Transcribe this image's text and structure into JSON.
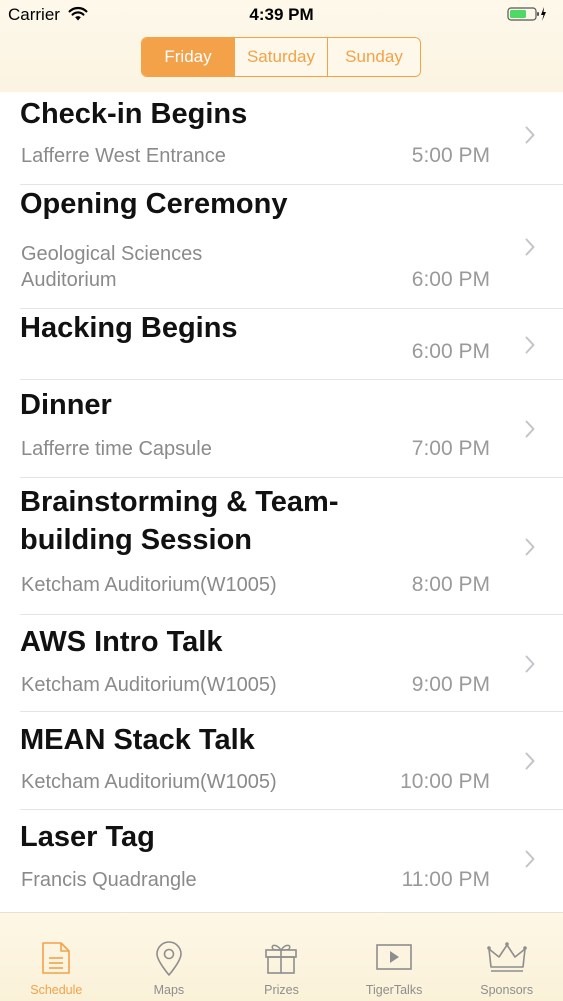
{
  "status_bar": {
    "carrier": "Carrier",
    "time": "4:39 PM"
  },
  "day_selector": {
    "days": [
      {
        "label": "Friday",
        "active": true
      },
      {
        "label": "Saturday",
        "active": false
      },
      {
        "label": "Sunday",
        "active": false
      }
    ]
  },
  "events": [
    {
      "title": "Check-in Begins",
      "location": "Lafferre West Entrance",
      "time": "5:00 PM"
    },
    {
      "title": "Opening Ceremony",
      "location": "Geological Sciences Auditorium",
      "time": "6:00 PM"
    },
    {
      "title": "Hacking Begins",
      "location": "",
      "time": "6:00 PM"
    },
    {
      "title": "Dinner",
      "location": "Lafferre time Capsule",
      "time": "7:00 PM"
    },
    {
      "title": "Brainstorming & Team-building Session",
      "location": "Ketcham Auditorium(W1005)",
      "time": "8:00 PM"
    },
    {
      "title": "AWS Intro Talk",
      "location": "Ketcham Auditorium(W1005)",
      "time": "9:00 PM"
    },
    {
      "title": "MEAN Stack Talk",
      "location": "Ketcham Auditorium(W1005)",
      "time": "10:00 PM"
    },
    {
      "title": "Laser Tag",
      "location": "Francis Quadrangle",
      "time": "11:00 PM"
    }
  ],
  "tab_bar": {
    "tabs": [
      {
        "label": "Schedule",
        "icon": "document-icon",
        "active": true
      },
      {
        "label": "Maps",
        "icon": "map-pin-icon",
        "active": false
      },
      {
        "label": "Prizes",
        "icon": "gift-icon",
        "active": false
      },
      {
        "label": "TigerTalks",
        "icon": "play-icon",
        "active": false
      },
      {
        "label": "Sponsors",
        "icon": "crown-icon",
        "active": false
      }
    ]
  },
  "colors": {
    "accent": "#f3a24a",
    "bar_background": "#fdf8ea",
    "secondary_text": "#8a8a8a"
  }
}
